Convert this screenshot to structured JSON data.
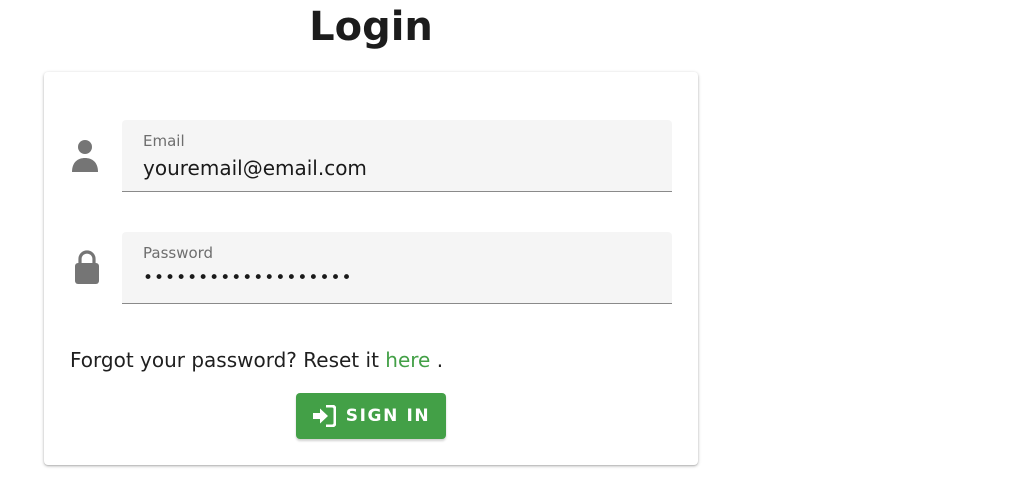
{
  "page": {
    "title": "Login"
  },
  "form": {
    "email": {
      "label": "Email",
      "value": "youremail@email.com",
      "icon": "person-icon"
    },
    "password": {
      "label": "Password",
      "value": "•••••••••••••••••••",
      "icon": "lock-icon"
    },
    "forgot": {
      "prefix": "Forgot your password? Reset it ",
      "link": "here",
      "suffix": " ."
    },
    "submit": {
      "label": "SIGN IN",
      "icon": "login-icon"
    }
  },
  "colors": {
    "accent": "#43a047",
    "icon": "#757575",
    "field_bg": "#f5f5f5"
  }
}
